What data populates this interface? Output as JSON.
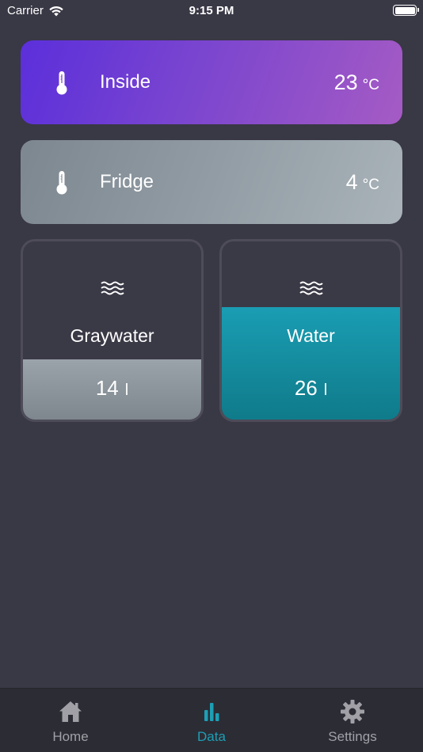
{
  "status_bar": {
    "carrier": "Carrier",
    "time": "9:15 PM"
  },
  "temperatures": [
    {
      "label": "Inside",
      "value": "23",
      "unit": "°C",
      "icon": "thermometer-icon",
      "colors": [
        "#5b2fdb",
        "#a55bc4"
      ]
    },
    {
      "label": "Fridge",
      "value": "4",
      "unit": "°C",
      "icon": "thermometer-icon",
      "colors": [
        "#7d8790",
        "#a9b3b9"
      ]
    }
  ],
  "tanks": [
    {
      "label": "Graywater",
      "value": "14",
      "unit": "l",
      "icon": "water-waves-icon",
      "fill_fraction": 0.34,
      "color": "#8b949b"
    },
    {
      "label": "Water",
      "value": "26",
      "unit": "l",
      "icon": "water-waves-icon",
      "fill_fraction": 0.63,
      "color": "#1a9db3"
    }
  ],
  "tab_bar": {
    "active": "Data",
    "accent_color": "#1d9fb5",
    "tabs": [
      {
        "label": "Home",
        "icon": "home-icon"
      },
      {
        "label": "Data",
        "icon": "bar-chart-icon"
      },
      {
        "label": "Settings",
        "icon": "gear-icon"
      }
    ]
  }
}
